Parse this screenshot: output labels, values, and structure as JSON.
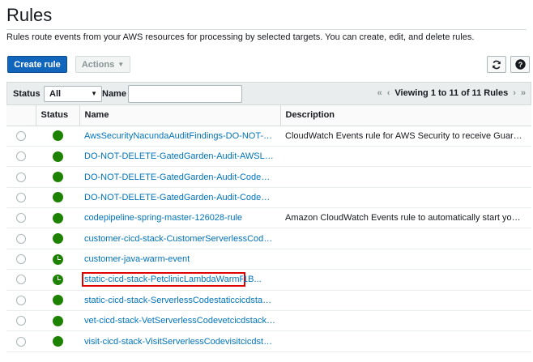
{
  "page": {
    "title": "Rules",
    "subtitle": "Rules route events from your AWS resources for processing by selected targets. You can create, edit, and delete rules."
  },
  "toolbar": {
    "create_label": "Create rule",
    "actions_label": "Actions",
    "refresh_icon": "refresh-icon",
    "help_icon": "help-icon"
  },
  "filter": {
    "status_label": "Status",
    "status_value": "All",
    "name_label": "Name",
    "name_value": "",
    "pager_text": "Viewing 1 to 11 of 11 Rules"
  },
  "table": {
    "headers": {
      "status": "Status",
      "name": "Name",
      "description": "Description"
    },
    "rows": [
      {
        "status": "enabled",
        "name": "AwsSecurityNacundaAuditFindings-DO-NOT-DELETE",
        "description": "CloudWatch Events rule for AWS Security to receive GuardDuty findings"
      },
      {
        "status": "enabled",
        "name": "DO-NOT-DELETE-GatedGarden-Audit-AWSLambda",
        "description": ""
      },
      {
        "status": "enabled",
        "name": "DO-NOT-DELETE-GatedGarden-Audit-CodeBuild",
        "description": ""
      },
      {
        "status": "enabled",
        "name": "DO-NOT-DELETE-GatedGarden-Audit-CodeDeploy",
        "description": ""
      },
      {
        "status": "enabled",
        "name": "codepipeline-spring-master-126028-rule",
        "description": "Amazon CloudWatch Events rule to automatically start your pipeline"
      },
      {
        "status": "enabled",
        "name": "customer-cicd-stack-CustomerServerlessCodec...",
        "description": ""
      },
      {
        "status": "scheduled",
        "name": "customer-java-warm-event",
        "description": ""
      },
      {
        "status": "scheduled",
        "name": "static-cicd-stack-PetclinicLambdaWarmRule",
        "name_tail": "1B...",
        "highlight": true,
        "description": ""
      },
      {
        "status": "enabled",
        "name": "static-cicd-stack-ServerlessCodestaticcicdstack...",
        "description": ""
      },
      {
        "status": "enabled",
        "name": "vet-cicd-stack-VetServerlessCodevetcicdstackS...",
        "description": ""
      },
      {
        "status": "enabled",
        "name": "visit-cicd-stack-VisitServerlessCodevisitcicdstac...",
        "description": ""
      }
    ]
  },
  "colors": {
    "primary": "#1166bb",
    "link": "#0073bb",
    "status_green": "#1d8102",
    "highlight": "#e00000"
  }
}
